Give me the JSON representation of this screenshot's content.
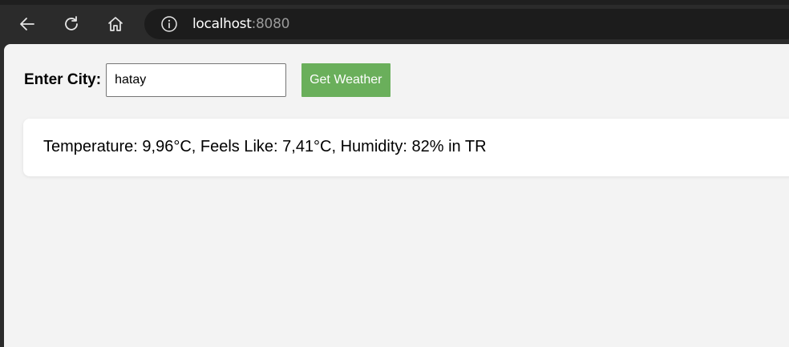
{
  "browser": {
    "url_host": "localhost",
    "url_port": ":8080",
    "icons": [
      "back-arrow-icon",
      "reload-icon",
      "home-icon",
      "info-icon"
    ]
  },
  "form": {
    "label": "Enter City:",
    "input_value": "hatay",
    "button_label": "Get Weather"
  },
  "result": {
    "text": "Temperature: 9,96°C, Feels Like: 7,41°C, Humidity: 82% in TR"
  },
  "colors": {
    "button_bg": "#6aaf5b",
    "page_bg": "#f3f3f3",
    "chrome_bg": "#2b2b2b"
  }
}
